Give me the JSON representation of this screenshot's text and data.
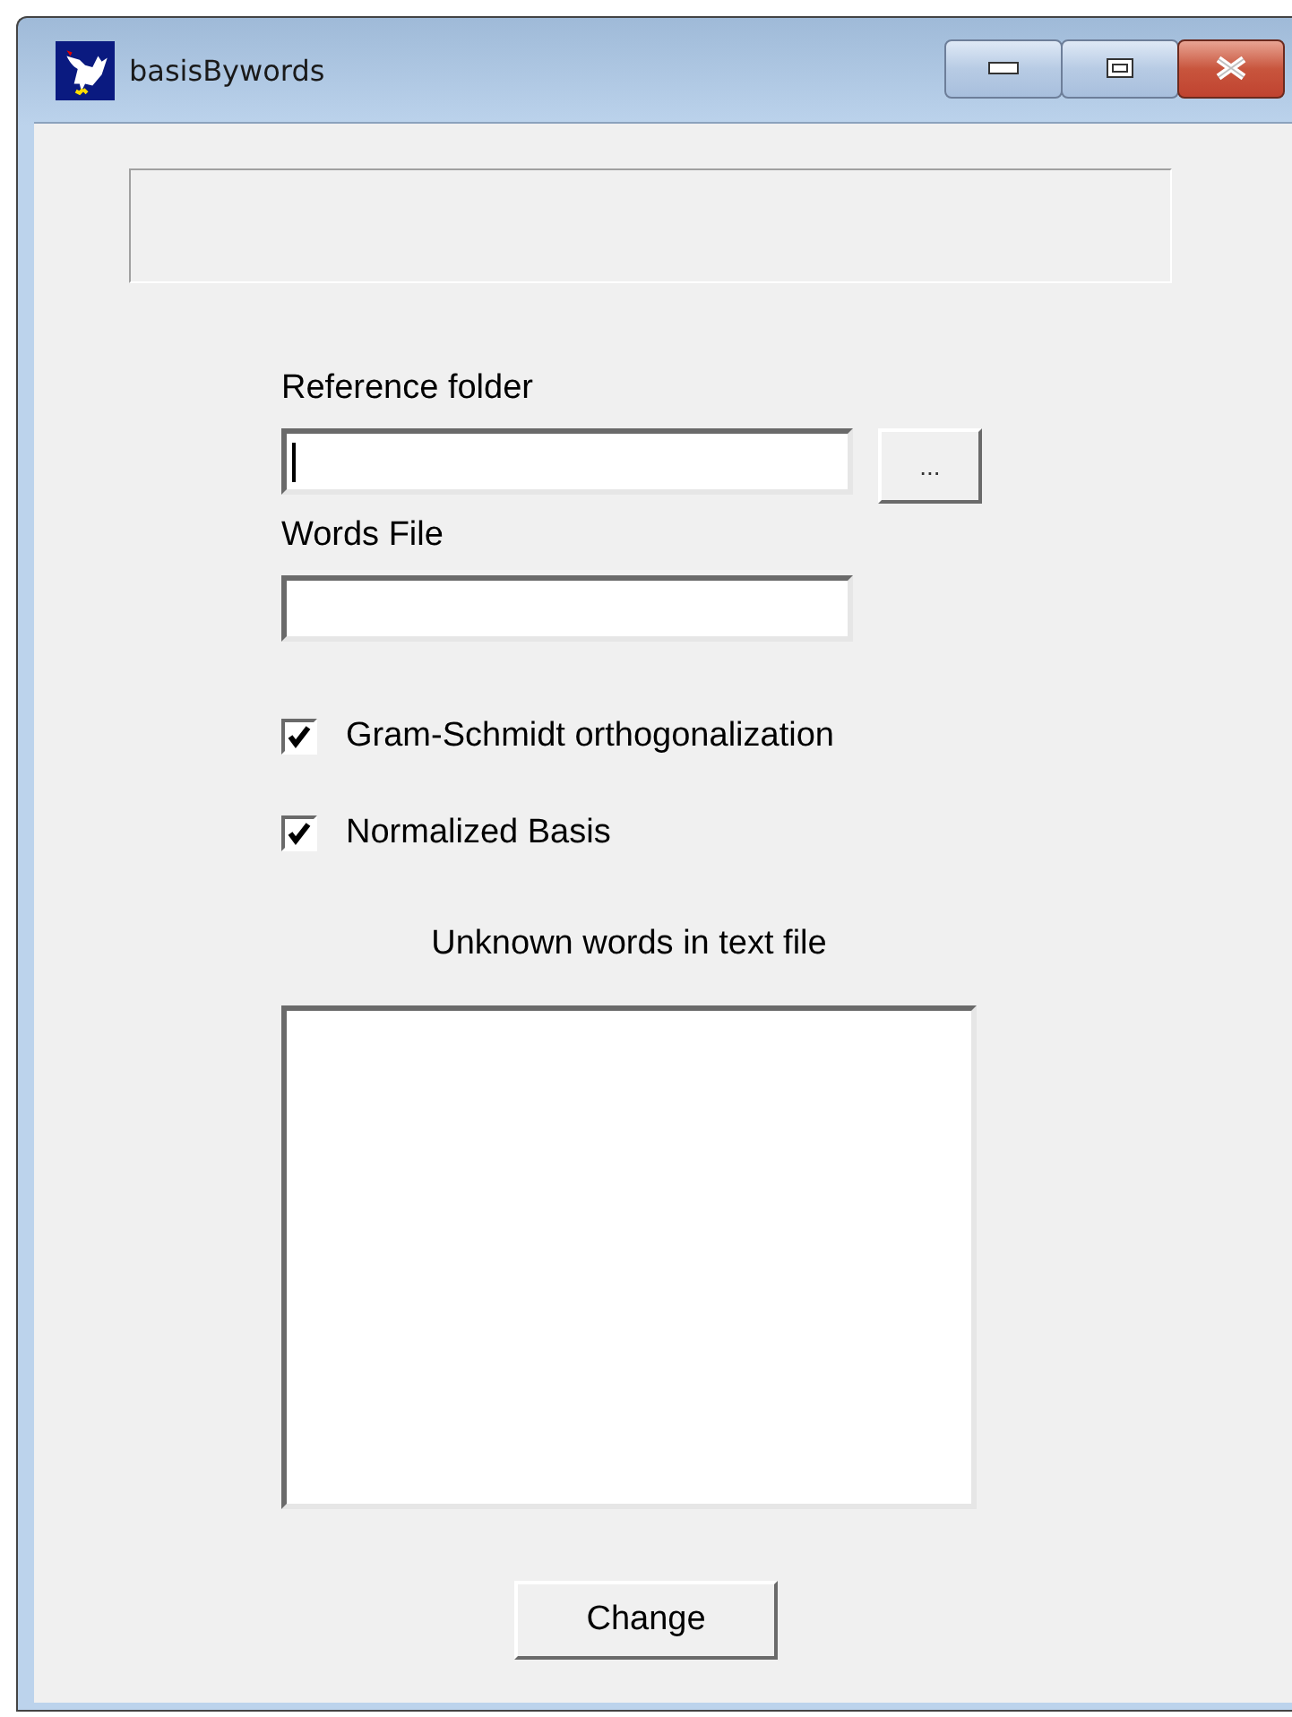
{
  "window": {
    "title": "basisBywords",
    "caption_buttons": [
      {
        "kind": "minimize"
      },
      {
        "kind": "maximize"
      },
      {
        "kind": "close"
      }
    ]
  },
  "fields": [
    {
      "label": "Reference folder",
      "focused": true,
      "browse_button": "..."
    },
    {
      "label": "Words File",
      "focused": false
    }
  ],
  "checkboxes": [
    {
      "label": "Gram-Schmidt orthogonalization",
      "checked": true
    },
    {
      "label": "Normalized Basis",
      "checked": true
    }
  ],
  "list_label": "Unknown words in text file",
  "button": "Change"
}
